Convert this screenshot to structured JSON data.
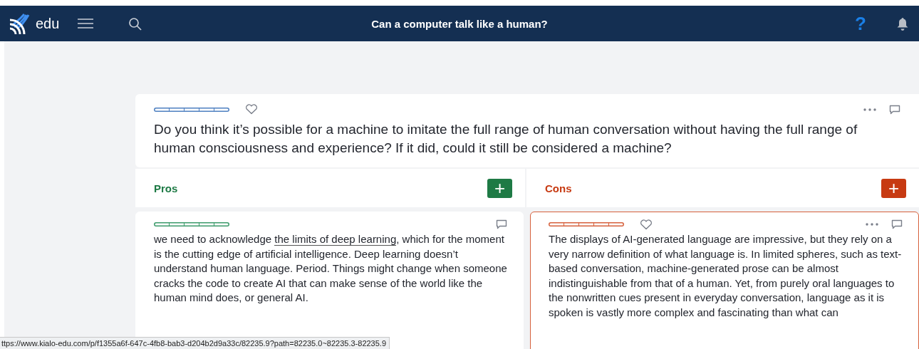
{
  "topbar": {
    "logo_text": "edu",
    "title": "Can a computer talk like a human?",
    "help": "?"
  },
  "thesis": {
    "text": "Do you think it’s possible for a machine to imitate the full range of human conversation without having the full range of human consciousness and experience? If it did, could it still be considered a machine?"
  },
  "columns": [
    {
      "kind": "pro",
      "label": "Pros",
      "add": "+"
    },
    {
      "kind": "con",
      "label": "Cons",
      "add": "+"
    }
  ],
  "claims": [
    {
      "kind": "pro",
      "hovered": false,
      "text_before": "we need to acknowledge ",
      "link": "the limits of deep learning",
      "text_after": ", which for the moment is the cutting edge of artificial intelligence. Deep learning doesn’t understand human language. Period. Things might change when someone cracks the code to create AI that can make sense of the world like the human mind does, or general AI."
    },
    {
      "kind": "con",
      "hovered": true,
      "text_before": "The displays of AI-generated language are impressive, but they rely on a very narrow definition of what language is. In limited spheres, such as text-based conversation, machine-generated prose can be almost indistinguishable from that of a human. Yet, from purely oral languages to the nonwritten cues present in everyday conversation, language as it is spoken is vastly more complex and fascinating than what can"
    }
  ],
  "status_url": "ttps://www.kialo-edu.com/p/f1355a6f-647c-4fb8-bab3-d204b2d9a33c/82235.9?path=82235.0~82235.3-82235.9"
}
